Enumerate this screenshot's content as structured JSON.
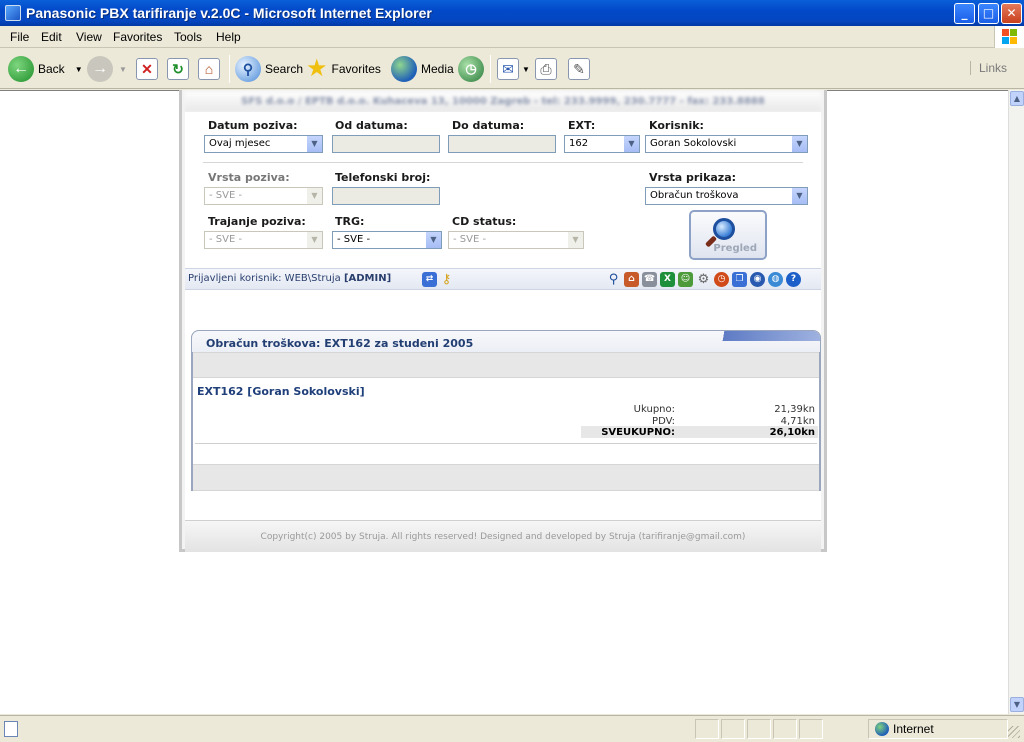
{
  "window": {
    "title": "Panasonic PBX tarifiranje v.2.0C - Microsoft Internet Explorer"
  },
  "menu": [
    "File",
    "Edit",
    "View",
    "Favorites",
    "Tools",
    "Help"
  ],
  "toolbar": {
    "back": "Back",
    "search": "Search",
    "favorites": "Favorites",
    "media": "Media",
    "links": "Links"
  },
  "page": {
    "header": "SFS d.o.o / EPTB d.o.o. Kuhaceva 13, 10000 Zagreb - tel: 233.9999, 230.7777 - fax: 233.8888",
    "form": {
      "datum_poziva": {
        "label": "Datum poziva:",
        "value": "Ovaj mjesec"
      },
      "od_datuma": {
        "label": "Od datuma:"
      },
      "do_datuma": {
        "label": "Do datuma:"
      },
      "ext": {
        "label": "EXT:",
        "value": "162"
      },
      "korisnik": {
        "label": "Korisnik:",
        "value": "Goran Sokolovski"
      },
      "vrsta_poziva": {
        "label": "Vrsta poziva:",
        "value": "- SVE -"
      },
      "telefonski_broj": {
        "label": "Telefonski broj:"
      },
      "vrsta_prikaza": {
        "label": "Vrsta prikaza:",
        "value": "Obračun troškova"
      },
      "trajanje_poziva": {
        "label": "Trajanje poziva:",
        "value": "- SVE -"
      },
      "trg": {
        "label": "TRG:",
        "value": "- SVE -"
      },
      "cd_status": {
        "label": "CD status:",
        "value": "- SVE -"
      },
      "pregled": "Pregled"
    },
    "userbar": {
      "prefix": "Prijavljeni korisnik: WEB\\Struja",
      "role": "[ADMIN]"
    },
    "report": {
      "title": "Obračun troškova: EXT162 za studeni 2005",
      "ext_title": "EXT162 [Goran Sokolovski]",
      "rows": [
        {
          "label": "Ukupno:",
          "value": "21,39kn"
        },
        {
          "label": "PDV:",
          "value": "4,71kn"
        },
        {
          "label": "SVEUKUPNO:",
          "value": "26,10kn"
        }
      ]
    },
    "footer": "Copyright(c) 2005 by Struja. All rights reserved! Designed and developed by Struja (tarifiranje@gmail.com)"
  },
  "status": {
    "zone": "Internet"
  }
}
